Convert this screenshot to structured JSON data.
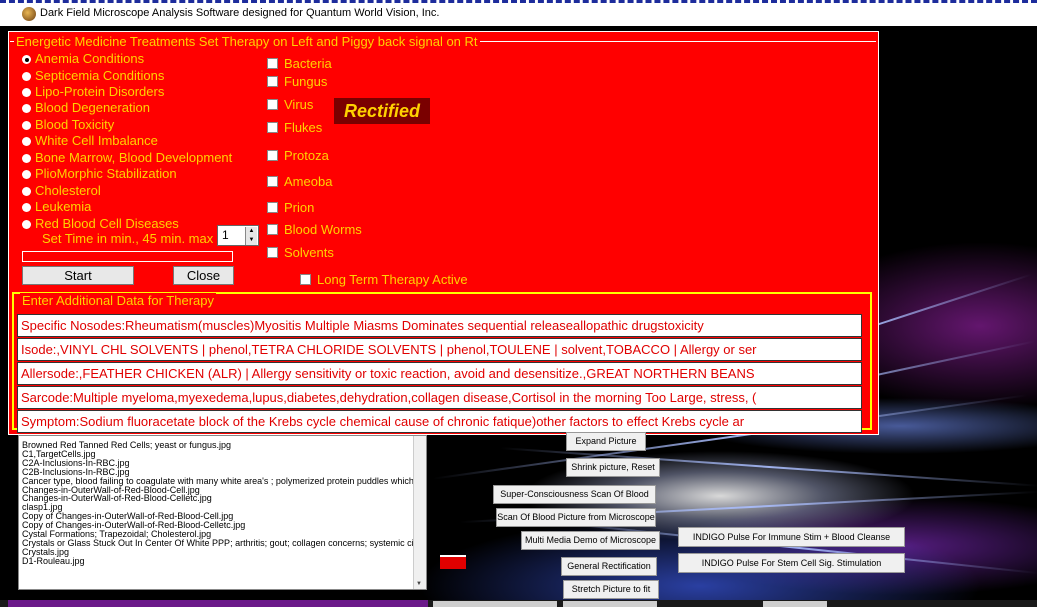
{
  "window": {
    "title": "Dark Field Microscope Analysis  Software designed for Quantum World Vision, Inc."
  },
  "therapy": {
    "legend": "Energetic Medicine Treatments   Set Therapy on Left and Piggy back signal on Rt",
    "conditions": [
      {
        "label": "Anemia Conditions",
        "selected": true
      },
      {
        "label": "Septicemia Conditions",
        "selected": false
      },
      {
        "label": "Lipo-Protein Disorders",
        "selected": false
      },
      {
        "label": "Blood Degeneration",
        "selected": false
      },
      {
        "label": "Blood Toxicity",
        "selected": false
      },
      {
        "label": "White Cell Imbalance",
        "selected": false
      },
      {
        "label": "Bone Marrow, Blood Development",
        "selected": false
      },
      {
        "label": "PlioMorphic Stabilization",
        "selected": false
      },
      {
        "label": "Cholesterol",
        "selected": false
      },
      {
        "label": "Leukemia",
        "selected": false
      },
      {
        "label": "Red Blood Cell Diseases",
        "selected": false
      }
    ],
    "piggyback": [
      {
        "label": "Bacteria",
        "checked": false
      },
      {
        "label": "Fungus",
        "checked": false
      },
      {
        "label": "Virus",
        "checked": false
      },
      {
        "label": "Flukes",
        "checked": false
      },
      {
        "label": "Protoza",
        "checked": false
      },
      {
        "label": "Ameoba",
        "checked": false
      },
      {
        "label": "Prion",
        "checked": false
      },
      {
        "label": "Blood Worms",
        "checked": false
      },
      {
        "label": "Solvents",
        "checked": false
      }
    ],
    "rectified_label": "Rectified",
    "set_time_label": "Set Time in min.,  45 min. max",
    "time_value": "1",
    "progress": 0,
    "start_label": "Start",
    "close_label": "Close",
    "long_term_label": "Long Term Therapy Active"
  },
  "additional": {
    "legend": "Enter Additional Data for Therapy",
    "fields": [
      "Specific Nosodes:Rheumatism(muscles)Myositis  Multiple Miasms Dominates sequential releaseallopathic drugstoxicity",
      "Isode:,VINYL CHL SOLVENTS | phenol,TETRA CHLORIDE SOLVENTS | phenol,TOULENE | solvent,TOBACCO | Allergy or ser",
      "Allersode:,FEATHER CHICKEN (ALR) | Allergy sensitivity or toxic reaction, avoid and desensitize.,GREAT NORTHERN BEANS",
      "Sarcode:Multiple myeloma,myexedema,lupus,diabetes,dehydration,collagen disease,Cortisol in the morning Too Large, stress, (",
      "Symptom:Sodium fluoracetate block of the Krebs cycle chemical cause of chronic fatique)other factors to effect Krebs cycle ar"
    ]
  },
  "files": [
    "Browned Red Tanned Red Cells; yeast or fungus.jpg",
    "C1,TargetCells.jpg",
    "C2A-Inclusions-In-RBC.jpg",
    "C2B-Inclusions-In-RBC.jpg",
    "Cancer type, blood failing to coagulate with many white area's ; polymerized protein puddles which refl",
    "Changes-in-OuterWall-of-Red-Blood-Cell.jpg",
    "Changes-in-OuterWall-of-Red-Blood-Celletc.jpg",
    "clasp1.jpg",
    "Copy of Changes-in-OuterWall-of-Red-Blood-Cell.jpg",
    "Copy of Changes-in-OuterWall-of-Red-Blood-Celletc.jpg",
    "Cystal Formations; Trapezoidal; Cholesterol.jpg",
    "Crystals or Glass Stuck Out In Center Of White PPP; arthritis; gout; collagen concerns; systemic circul",
    "Crystals.jpg",
    "D1-Rouleau.jpg"
  ],
  "actions": {
    "expand": "Expand Picture",
    "shrink": "Shrink picture, Reset",
    "super": "Super-Consciousness Scan Of Blood",
    "scan": "Scan Of Blood Picture from Microscope",
    "multimedia": "Multi Media Demo of Microscope",
    "general": "General Rectification",
    "stretch": "Stretch Picture to fit",
    "indigo_immune": "INDIGO Pulse For Immune Stim + Blood Cleanse",
    "indigo_stem": "INDIGO Pulse For Stem Cell Sig. Stimulation"
  },
  "colors": {
    "panel": "#ff0000",
    "label": "#ffd200",
    "field_text": "#e00000",
    "border": "#ffff00"
  }
}
